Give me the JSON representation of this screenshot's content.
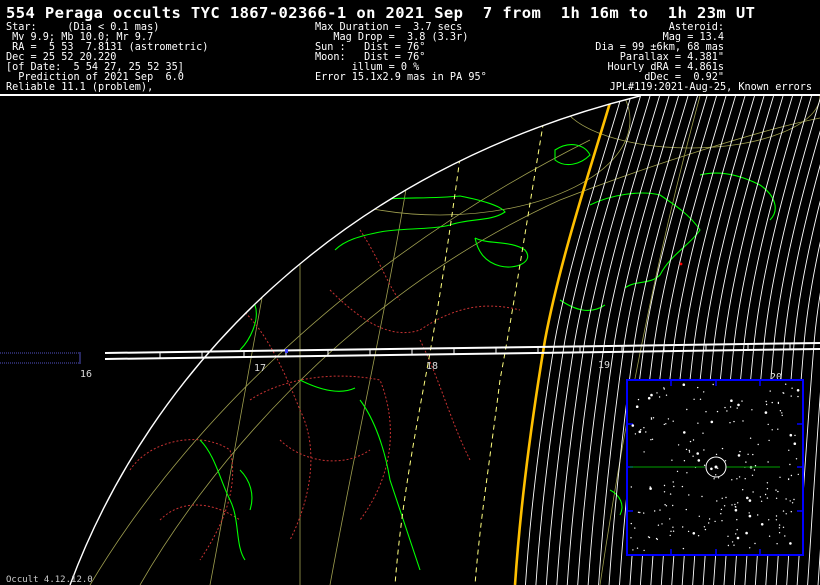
{
  "title": "554 Peraga occults TYC 1867-02366-1 on 2021 Sep  7 from  1h 16m to  1h 23m UT",
  "star": {
    "lines": [
      "Star:     (Dia < 0.1 mas)",
      " Mv 9.9; Mb 10.0; Mr 9.7",
      " RA =  5 53  7.8131 (astrometric)",
      "Dec = 25 52 20.220",
      "[of Date:  5 54 27, 25 52 35]",
      "  Prediction of 2021 Sep  6.0",
      "Reliable 11.1 (problem),"
    ]
  },
  "event": {
    "lines": [
      "Max Duration =  3.7 secs",
      "   Mag Drop =  3.8 (3.3r)",
      "Sun :   Dist = 76°",
      "Moon:   Dist = 76°",
      "      illum = 0 %",
      "Error 15.1x2.9 mas in PA 95°"
    ]
  },
  "asteroid": {
    "lines": [
      "Asteroid:",
      "Mag = 13.4",
      "Dia = 99 ±6km, 68 mas",
      "Parallax = 4.381\"",
      "Hourly dRA = 4.861s",
      "dDec =  0.92\"",
      "JPL#119:2021-Aug-25, Known errors"
    ]
  },
  "map": {
    "longitude_labels": [
      "16",
      "17",
      "18",
      "19",
      "20"
    ],
    "colors": {
      "background": "#000000",
      "coastline": "#00ff00",
      "borders": "#c83232",
      "grid": "#a0a050",
      "path_edge": "#ffffff",
      "error_lines": "#ffff80",
      "sunrise_line": "#ffc000",
      "night_hatch": "#ffffff",
      "inset_border": "#0000ff"
    }
  },
  "inset": {
    "label": "star-field",
    "target_icon": "star-circle-icon"
  },
  "footer": {
    "version": "Occult 4.12.12.0"
  }
}
